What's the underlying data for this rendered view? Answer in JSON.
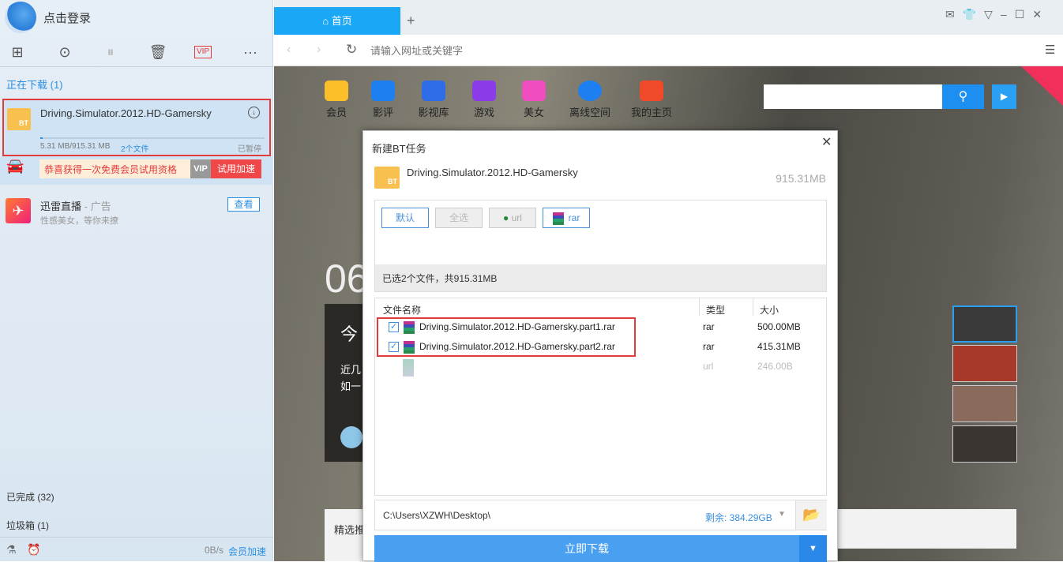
{
  "sidebar": {
    "login": "点击登录",
    "downloading": "正在下载 (1)",
    "task": {
      "name": "Driving.Simulator.2012.HD-Gamersky",
      "progress_text": "5.31 MB/915.31 MB",
      "files": "2个文件",
      "status": "已暂停",
      "progress": 0.0058
    },
    "promo": {
      "text": "恭喜获得一次免费会员试用资格",
      "vip": "VIP",
      "button": "试用加速"
    },
    "ad": {
      "title": "迅雷直播",
      "tag": " - 广告",
      "subtitle": "性感美女，等你来撩",
      "button": "查看"
    },
    "completed": "已完成 (32)",
    "trash": "垃圾箱 (1)",
    "speed": "0B/s",
    "speedup": "会员加速",
    "toolbar_vip": "VIP"
  },
  "browser": {
    "tab": "首页",
    "new_tab": "+",
    "address_placeholder": "请输入网址或关键字",
    "nav": [
      "会员",
      "影评",
      "影视库",
      "游戏",
      "美女",
      "离线空间",
      "我的主页"
    ],
    "bg_big": "06",
    "bg_title": "今",
    "bg_text1": "近几",
    "bg_text2": "如一",
    "bg_bottom": "精选推"
  },
  "dialog": {
    "title": "新建BT任务",
    "name": "Driving.Simulator.2012.HD-Gamersky",
    "size": "915.31MB",
    "filters": {
      "default": "默认",
      "all": "全选",
      "url": "url",
      "rar": "rar"
    },
    "summary": "已选2个文件，共915.31MB",
    "columns": {
      "name": "文件名称",
      "type": "类型",
      "size": "大小"
    },
    "files": [
      {
        "name": "Driving.Simulator.2012.HD-Gamersky.part1.rar",
        "type": "rar",
        "size": "500.00MB",
        "checked": true
      },
      {
        "name": "Driving.Simulator.2012.HD-Gamersky.part2.rar",
        "type": "rar",
        "size": "415.31MB",
        "checked": true
      },
      {
        "name": "",
        "type": "url",
        "size": "246.00B",
        "checked": false
      }
    ],
    "path": "C:\\Users\\XZWH\\Desktop\\",
    "free": "剩余: 384.29GB",
    "download": "立即下载"
  },
  "colors": {
    "accent": "#1aa7f5",
    "highlight": "#e23b3b"
  }
}
